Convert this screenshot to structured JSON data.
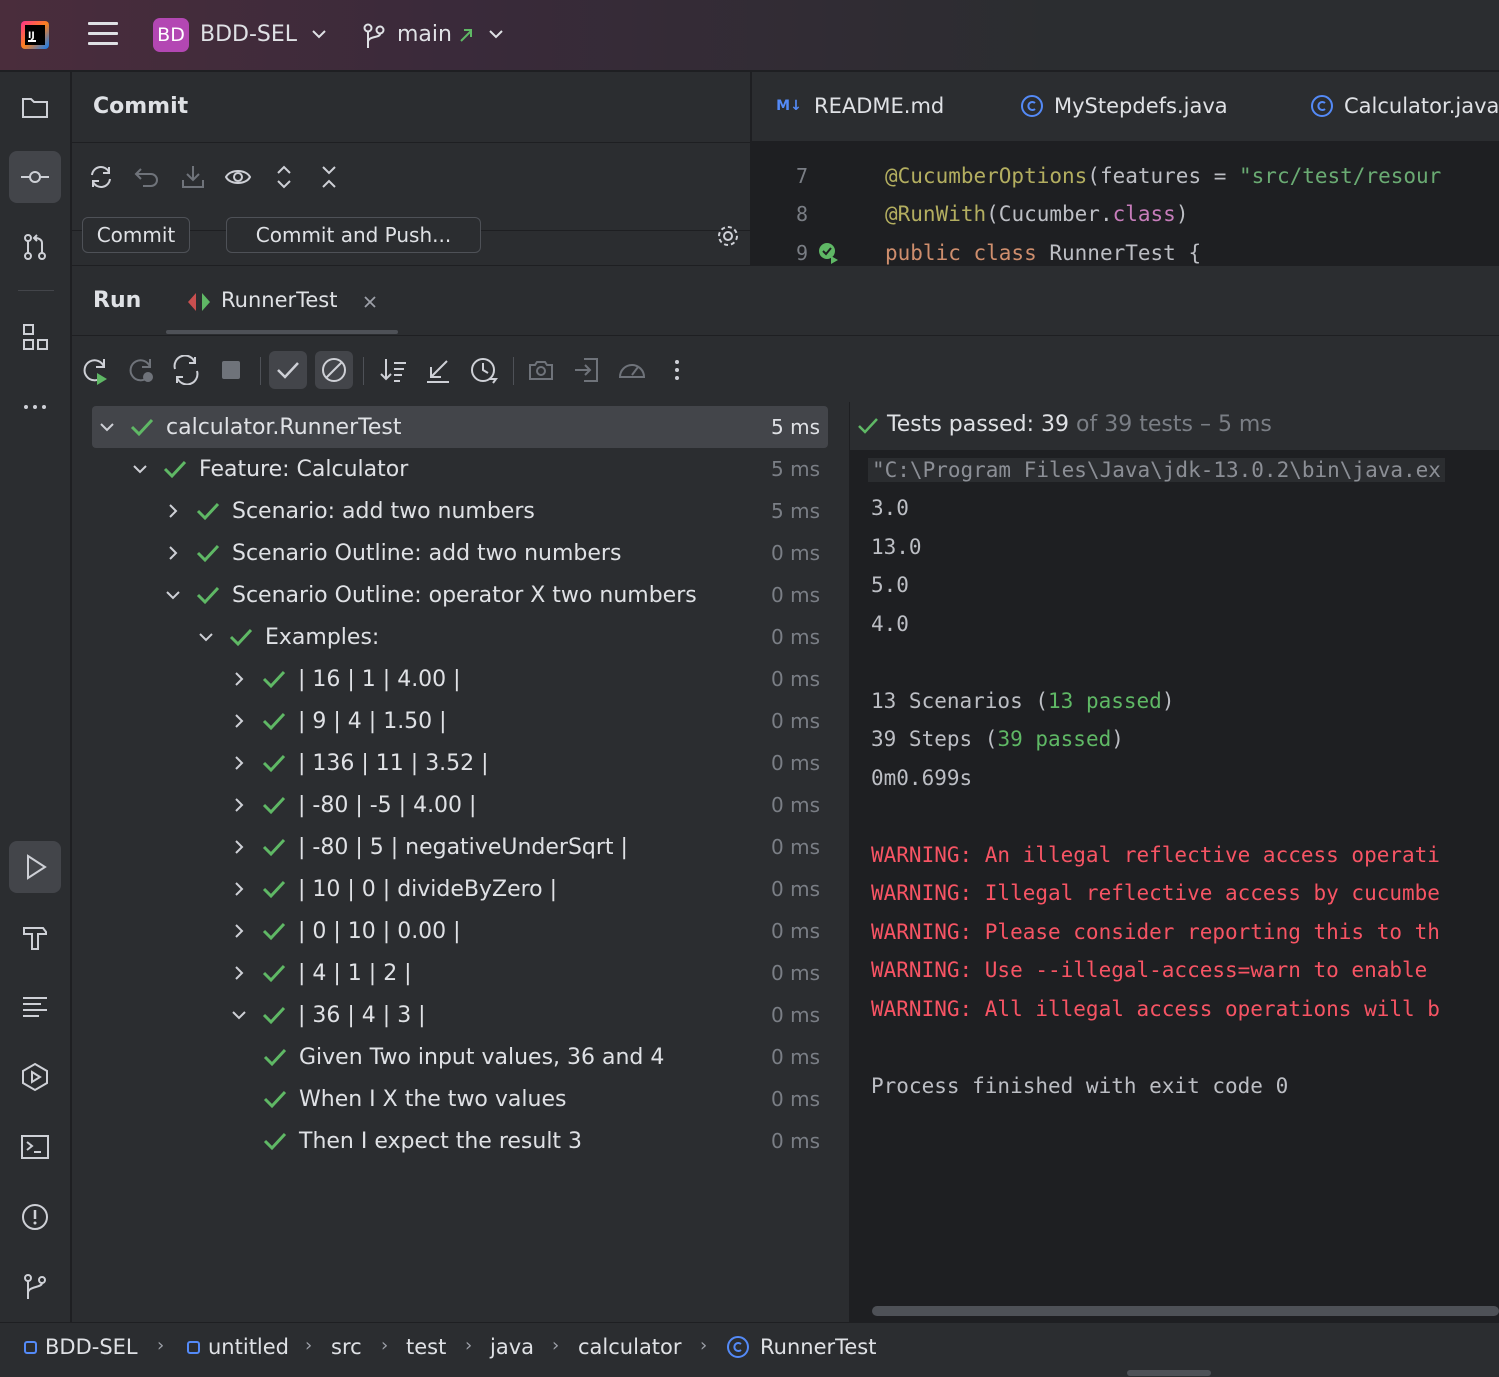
{
  "titlebar": {
    "project_badge": "BD",
    "project_name": "BDD-SEL",
    "branch": "main"
  },
  "commit": {
    "title": "Commit",
    "commit_button": "Commit",
    "commit_push_button": "Commit and Push..."
  },
  "editor": {
    "tabs": [
      {
        "label": "README.md",
        "icon": "markdown-icon"
      },
      {
        "label": "MyStepdefs.java",
        "icon": "class-icon"
      },
      {
        "label": "Calculator.java",
        "icon": "class-icon"
      }
    ],
    "lines": [
      {
        "num": "7"
      },
      {
        "num": "8"
      },
      {
        "num": "9"
      }
    ],
    "code": {
      "l7_ann": "@CucumberOptions",
      "l7_rest": "(features = ",
      "l7_str": "\"src/test/resour",
      "l8_ann": "@RunWith",
      "l8_rest": "(Cucumber.",
      "l8_field": "class",
      "l8_end": ")",
      "l9_kw": "public class ",
      "l9_name": "RunnerTest {"
    }
  },
  "run": {
    "title": "Run",
    "tab_label": "RunnerTest",
    "tree": [
      {
        "label": "calculator.RunnerTest",
        "time": "5 ms",
        "indent": 0,
        "chevron": "down",
        "selected": true
      },
      {
        "label": "Feature: Calculator",
        "time": "5 ms",
        "indent": 1,
        "chevron": "down"
      },
      {
        "label": "Scenario: add two numbers",
        "time": "5 ms",
        "indent": 2,
        "chevron": "right"
      },
      {
        "label": "Scenario Outline: add two numbers",
        "time": "0 ms",
        "indent": 2,
        "chevron": "right"
      },
      {
        "label": "Scenario Outline: operator X two numbers",
        "time": "0 ms",
        "indent": 2,
        "chevron": "down"
      },
      {
        "label": "Examples:",
        "time": "0 ms",
        "indent": 3,
        "chevron": "down"
      },
      {
        "label": "| 16 | 1 | 4.00 |",
        "time": "0 ms",
        "indent": 4,
        "chevron": "right"
      },
      {
        "label": "| 9 | 4 | 1.50 |",
        "time": "0 ms",
        "indent": 4,
        "chevron": "right"
      },
      {
        "label": "| 136 | 11 | 3.52 |",
        "time": "0 ms",
        "indent": 4,
        "chevron": "right"
      },
      {
        "label": "| -80 | -5 | 4.00 |",
        "time": "0 ms",
        "indent": 4,
        "chevron": "right"
      },
      {
        "label": "| -80 | 5 | negativeUnderSqrt |",
        "time": "0 ms",
        "indent": 4,
        "chevron": "right"
      },
      {
        "label": "| 10 | 0 | divideByZero |",
        "time": "0 ms",
        "indent": 4,
        "chevron": "right"
      },
      {
        "label": "| 0 | 10 | 0.00 |",
        "time": "0 ms",
        "indent": 4,
        "chevron": "right"
      },
      {
        "label": "| 4 | 1 | 2 |",
        "time": "0 ms",
        "indent": 4,
        "chevron": "right"
      },
      {
        "label": "| 36 | 4 | 3 |",
        "time": "0 ms",
        "indent": 4,
        "chevron": "down"
      },
      {
        "label": "Given Two input values, 36 and 4",
        "time": "0 ms",
        "indent": 5,
        "chevron": "none"
      },
      {
        "label": "When I X the two values",
        "time": "0 ms",
        "indent": 5,
        "chevron": "none"
      },
      {
        "label": "Then I expect the result 3",
        "time": "0 ms",
        "indent": 5,
        "chevron": "none"
      }
    ],
    "summary": {
      "passed_label": "Tests passed: 39",
      "rest": " of 39 tests – 5 ms"
    },
    "console": {
      "cmd": "\"C:\\Program Files\\Java\\jdk-13.0.2\\bin\\java.ex",
      "out1": "3.0",
      "out2": "13.0",
      "out3": "5.0",
      "out4": "4.0",
      "scen_a": "13 Scenarios (",
      "scen_b": "13 passed",
      "scen_c": ")",
      "steps_a": "39 Steps (",
      "steps_b": "39 passed",
      "steps_c": ")",
      "time": "0m0.699s",
      "warn1": "WARNING: An illegal reflective access operati",
      "warn2": "WARNING: Illegal reflective access by cucumbe",
      "warn3": "WARNING: Please consider reporting this to th",
      "warn4": "WARNING: Use --illegal-access=warn to enable ",
      "warn5": "WARNING: All illegal access operations will b",
      "exit": "Process finished with exit code 0"
    }
  },
  "statusbar": {
    "crumbs": [
      "BDD-SEL",
      "untitled",
      "src",
      "test",
      "java",
      "calculator",
      "RunnerTest"
    ]
  },
  "colors": {
    "accent_green": "#5fb865",
    "warning_red": "#f75464",
    "project_badge": "#b347b3",
    "link_blue": "#548af7"
  }
}
